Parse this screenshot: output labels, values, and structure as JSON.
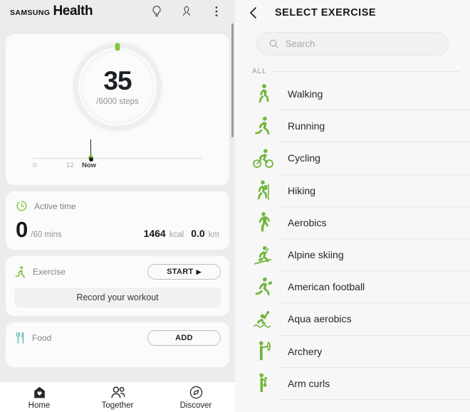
{
  "left": {
    "header": {
      "brand_samsung": "SAMSUNG",
      "brand_health": "Health",
      "icons": [
        "tips-bulb-icon",
        "profile-icon",
        "more-options-icon"
      ]
    },
    "steps_card": {
      "value": "35",
      "goal_text": "/6000 steps",
      "progress_percent": 0.6,
      "ring_color": "#86c440",
      "timeline": {
        "labels": [
          "0",
          "12",
          "Now"
        ],
        "marker_label": "Now"
      }
    },
    "active_time_card": {
      "icon": "active-time-clock-icon",
      "label": "Active time",
      "value": "0",
      "unit": "/60 mins",
      "calories_value": "1464",
      "calories_unit": "kcal",
      "distance_value": "0.0",
      "distance_unit": "km"
    },
    "exercise_card": {
      "icon": "running-person-icon",
      "label": "Exercise",
      "start_label": "START",
      "start_glyph": "▶",
      "record_label": "Record your workout"
    },
    "food_card": {
      "icon": "fork-knife-icon",
      "label": "Food",
      "add_label": "ADD"
    },
    "bottom_nav": [
      {
        "label": "Home",
        "icon": "home-heart-icon",
        "active": true
      },
      {
        "label": "Together",
        "icon": "people-icon",
        "active": false
      },
      {
        "label": "Discover",
        "icon": "compass-icon",
        "active": false
      }
    ]
  },
  "right": {
    "header": {
      "back_icon": "chevron-left-icon",
      "title": "SELECT EXERCISE"
    },
    "search": {
      "icon": "search-icon",
      "placeholder": "Search",
      "value": ""
    },
    "section_label": "ALL",
    "exercises": [
      {
        "name": "Walking",
        "icon": "walking-icon"
      },
      {
        "name": "Running",
        "icon": "running-icon"
      },
      {
        "name": "Cycling",
        "icon": "cycling-icon"
      },
      {
        "name": "Hiking",
        "icon": "hiking-icon"
      },
      {
        "name": "Aerobics",
        "icon": "aerobics-icon"
      },
      {
        "name": "Alpine skiing",
        "icon": "alpine-skiing-icon"
      },
      {
        "name": "American football",
        "icon": "american-football-icon"
      },
      {
        "name": "Aqua aerobics",
        "icon": "aqua-aerobics-icon"
      },
      {
        "name": "Archery",
        "icon": "archery-icon"
      },
      {
        "name": "Arm curls",
        "icon": "arm-curls-icon"
      }
    ]
  },
  "colors": {
    "accent_green": "#86c440",
    "food_teal": "#6fc0b8",
    "text_dark": "#1c2024",
    "text_muted": "#8a9096",
    "panel_bg": "#ececec"
  }
}
